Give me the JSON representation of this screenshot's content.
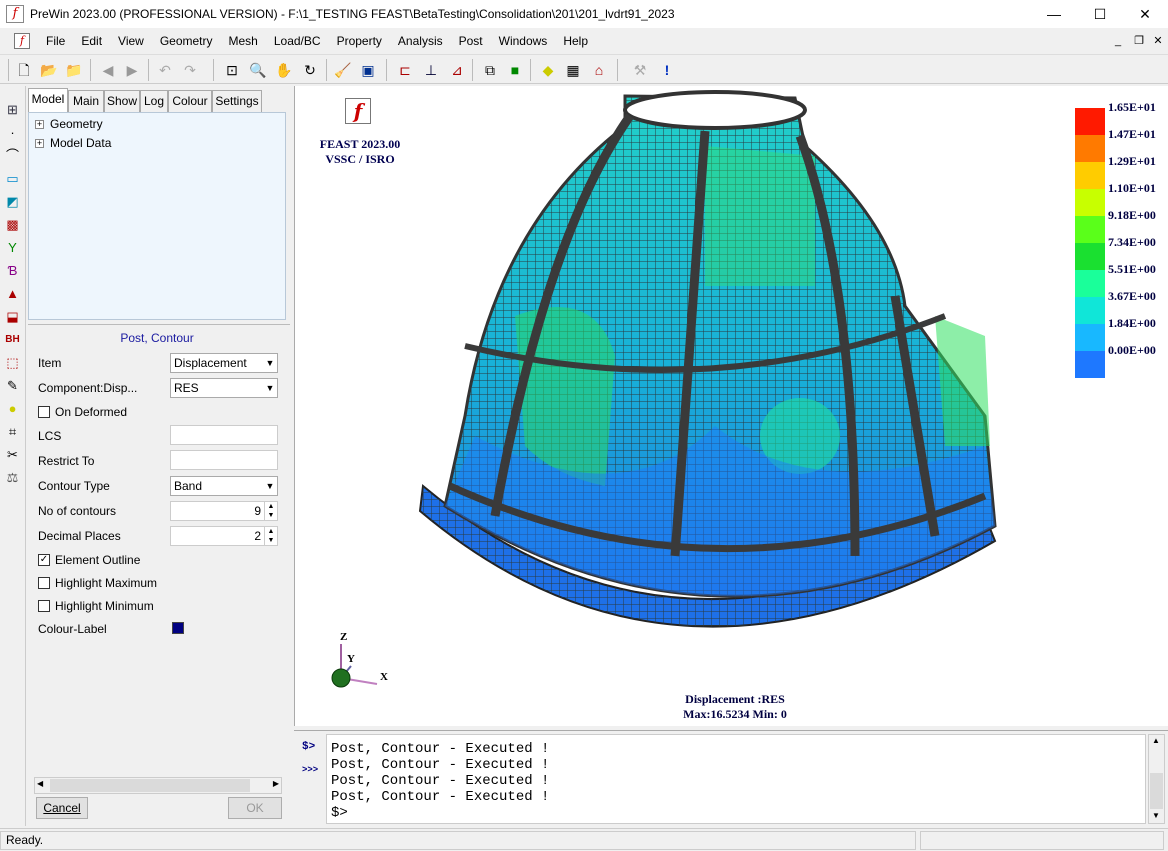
{
  "window": {
    "title": "PreWin 2023.00 (PROFESSIONAL VERSION) - F:\\1_TESTING FEAST\\BetaTesting\\Consolidation\\201\\201_lvdrt91_2023",
    "app_icon": "f",
    "minimize": "—",
    "maximize": "☐",
    "close": "✕"
  },
  "menu": [
    "File",
    "Edit",
    "View",
    "Geometry",
    "Mesh",
    "Load/BC",
    "Property",
    "Analysis",
    "Post",
    "Windows",
    "Help"
  ],
  "left_panel": {
    "tabs": [
      "Model",
      "Main",
      "Show",
      "Log",
      "Colour",
      "Settings"
    ],
    "active_tab": "Model",
    "tree": [
      "Geometry",
      "Model Data"
    ],
    "props_title": "Post, Contour",
    "item_label": "Item",
    "item_value": "Displacement",
    "component_label": "Component:Disp...",
    "component_value": "RES",
    "on_deformed_label": "On Deformed",
    "lcs_label": "LCS",
    "restrict_label": "Restrict To",
    "contour_type_label": "Contour Type",
    "contour_type_value": "Band",
    "no_contours_label": "No of contours",
    "no_contours_value": "9",
    "decimal_label": "Decimal Places",
    "decimal_value": "2",
    "element_outline_label": "Element Outline",
    "highlight_max_label": "Highlight Maximum",
    "highlight_min_label": "Highlight Minimum",
    "colour_label": "Colour-Label",
    "colour_label_color": "#000080",
    "cancel_label": "Cancel",
    "ok_label": "OK"
  },
  "viewport": {
    "brand_line1": "FEAST 2023.00",
    "brand_line2": "VSSC / ISRO",
    "logo": "f",
    "legend": [
      {
        "label": "1.65E+01",
        "color": "#ff1a00"
      },
      {
        "label": "1.47E+01",
        "color": "#ff7a00"
      },
      {
        "label": "1.29E+01",
        "color": "#ffcc00"
      },
      {
        "label": "1.10E+01",
        "color": "#c8ff00"
      },
      {
        "label": "9.18E+00",
        "color": "#5aff1a"
      },
      {
        "label": "7.34E+00",
        "color": "#1ae030"
      },
      {
        "label": "5.51E+00",
        "color": "#1aff9a"
      },
      {
        "label": "3.67E+00",
        "color": "#10e6d8"
      },
      {
        "label": "1.84E+00",
        "color": "#18b8ff"
      },
      {
        "label": "0.00E+00",
        "color": "#1e78ff"
      }
    ],
    "axis_z": "Z",
    "axis_y": "Y",
    "axis_x": "X",
    "result_line1": "Displacement :RES",
    "result_line2": "Max:16.5234  Min: 0"
  },
  "console": {
    "prompt1": "$>",
    "prompt2": ">>>",
    "lines": [
      "Post, Contour - Executed !",
      "Post, Contour - Executed !",
      "Post, Contour - Executed !",
      "Post, Contour - Executed !",
      "$>"
    ]
  },
  "status": {
    "text": "Ready."
  }
}
